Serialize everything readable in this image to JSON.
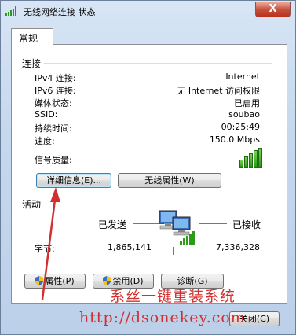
{
  "window": {
    "title": "无线网络连接 状态",
    "close_label": "X"
  },
  "tabs": [
    {
      "label": "常规"
    }
  ],
  "connection": {
    "group_label": "连接",
    "rows": [
      {
        "label": "IPv4 连接:",
        "value": "Internet"
      },
      {
        "label": "IPv6 连接:",
        "value": "无 Internet 访问权限"
      },
      {
        "label": "媒体状态:",
        "value": "已启用"
      },
      {
        "label": "SSID:",
        "value": "soubao"
      },
      {
        "label": "持续时间:",
        "value": "00:25:49"
      },
      {
        "label": "速度:",
        "value": "150.0 Mbps"
      }
    ],
    "signal_label": "信号质量:",
    "signal_level": "5/5",
    "details_button": "详细信息(E)...",
    "wireless_props_button": "无线属性(W)"
  },
  "activity": {
    "group_label": "活动",
    "sent_label": "已发送",
    "received_label": "已接收",
    "bytes_label": "字节:",
    "bytes_sent": "1,865,141",
    "bytes_received": "7,336,328"
  },
  "buttons": {
    "properties": "属性(P)",
    "disable": "禁用(D)",
    "diagnose": "诊断(G)",
    "close": "关闭(C)"
  },
  "watermark": {
    "line1": "系丝一键重装系统",
    "line2": "http://dsonekey.com"
  },
  "colors": {
    "accent_red": "#d23030",
    "signal_green": "#2d9a1a"
  }
}
